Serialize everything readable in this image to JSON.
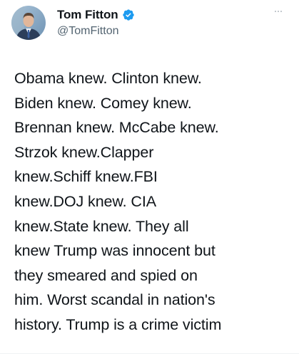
{
  "author": {
    "display_name": "Tom Fitton",
    "handle": "@TomFitton",
    "verified": true,
    "avatar_icon": "profile-photo",
    "verified_icon": "verified-badge-icon"
  },
  "tweet": {
    "text": "Obama knew. Clinton knew.\nBiden knew. Comey knew.\nBrennan knew. McCabe knew.\nStrzok knew.Clapper\nknew.Schiff knew.FBI\nknew.DOJ knew. CIA\nknew.State knew. They all\nknew Trump was innocent but\nthey smeared and spied on\nhim. Worst scandal in nation's\nhistory. Trump is a crime victim"
  },
  "menu": {
    "more_icon": "more-options-icon"
  },
  "colors": {
    "text": "#0f1419",
    "secondary": "#536471",
    "verified": "#1d9bf0"
  }
}
